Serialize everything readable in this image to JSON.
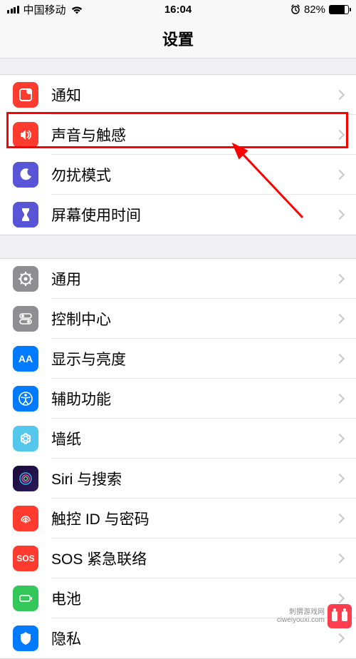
{
  "status": {
    "carrier": "中国移动",
    "time": "16:04",
    "battery_pct": "82%"
  },
  "header": {
    "title": "设置"
  },
  "group1": [
    {
      "id": "notifications",
      "label": "通知",
      "iconClass": "ic-red"
    },
    {
      "id": "sounds",
      "label": "声音与触感",
      "iconClass": "ic-red",
      "highlighted": true
    },
    {
      "id": "dnd",
      "label": "勿扰模式",
      "iconClass": "ic-purple"
    },
    {
      "id": "screentime",
      "label": "屏幕使用时间",
      "iconClass": "ic-purple"
    }
  ],
  "group2": [
    {
      "id": "general",
      "label": "通用",
      "iconClass": "ic-grey"
    },
    {
      "id": "controlcenter",
      "label": "控制中心",
      "iconClass": "ic-grey"
    },
    {
      "id": "display",
      "label": "显示与亮度",
      "iconClass": "ic-blue"
    },
    {
      "id": "accessibility",
      "label": "辅助功能",
      "iconClass": "ic-blue"
    },
    {
      "id": "wallpaper",
      "label": "墙纸",
      "iconClass": "ic-cyan"
    },
    {
      "id": "siri",
      "label": "Siri 与搜索",
      "iconClass": "ic-siri"
    },
    {
      "id": "touchid",
      "label": "触控 ID 与密码",
      "iconClass": "ic-red"
    },
    {
      "id": "sos",
      "label": "SOS 紧急联络",
      "iconClass": "ic-sos"
    },
    {
      "id": "battery",
      "label": "电池",
      "iconClass": "ic-green"
    },
    {
      "id": "privacy",
      "label": "隐私",
      "iconClass": "ic-blue"
    }
  ],
  "watermark": {
    "line1": "刺猬游戏网",
    "line2": "ciweiyouxi.com"
  }
}
